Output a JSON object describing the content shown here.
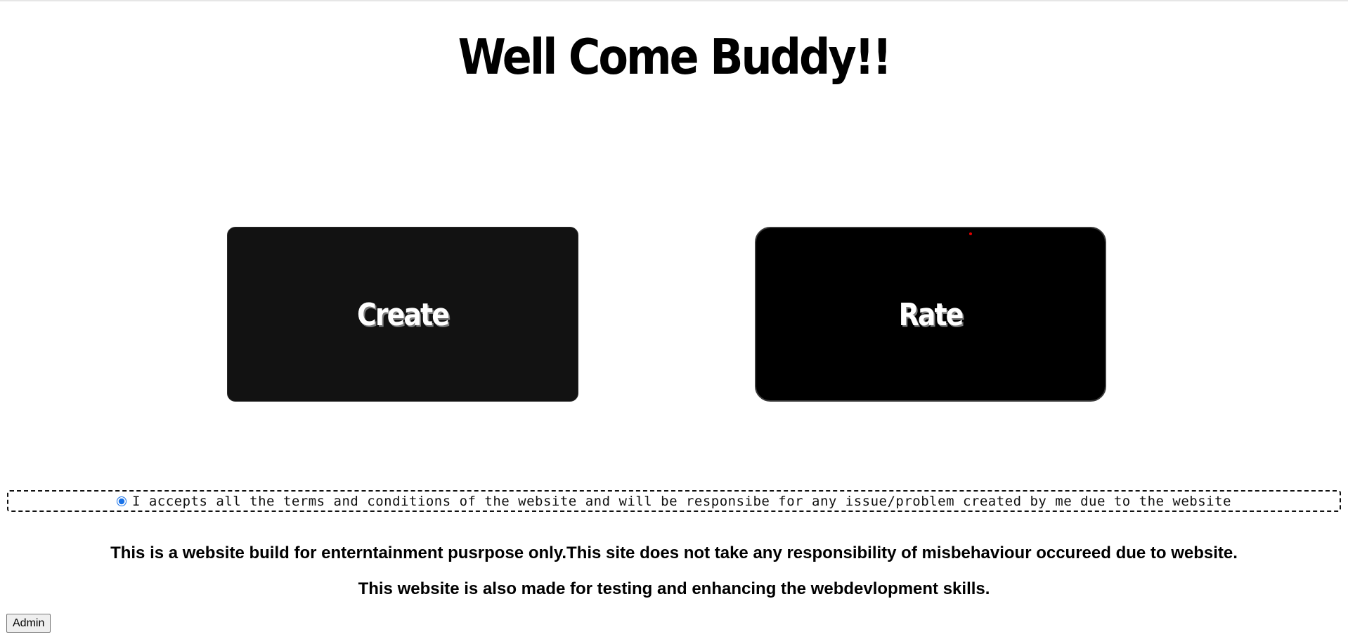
{
  "header": {
    "title": "Well Come Buddy!!"
  },
  "actions": {
    "create_label": "Create",
    "rate_label": "Rate"
  },
  "terms": {
    "selected": true,
    "text": "I accepts all the terms and conditions of the website and will be responsibe for any issue/problem created by me due to the website"
  },
  "footer": {
    "disclaimer_1": "This is a website build for enterntainment pusrpose only.This site does not take any responsibility of misbehaviour occureed due to website.",
    "disclaimer_2": "This website is also made for testing and enhancing the webdevlopment skills.",
    "admin_label": "Admin"
  },
  "colors": {
    "card_background": "#121212",
    "accent_radio": "#1a73e8",
    "indicator_dot": "#e00000"
  }
}
